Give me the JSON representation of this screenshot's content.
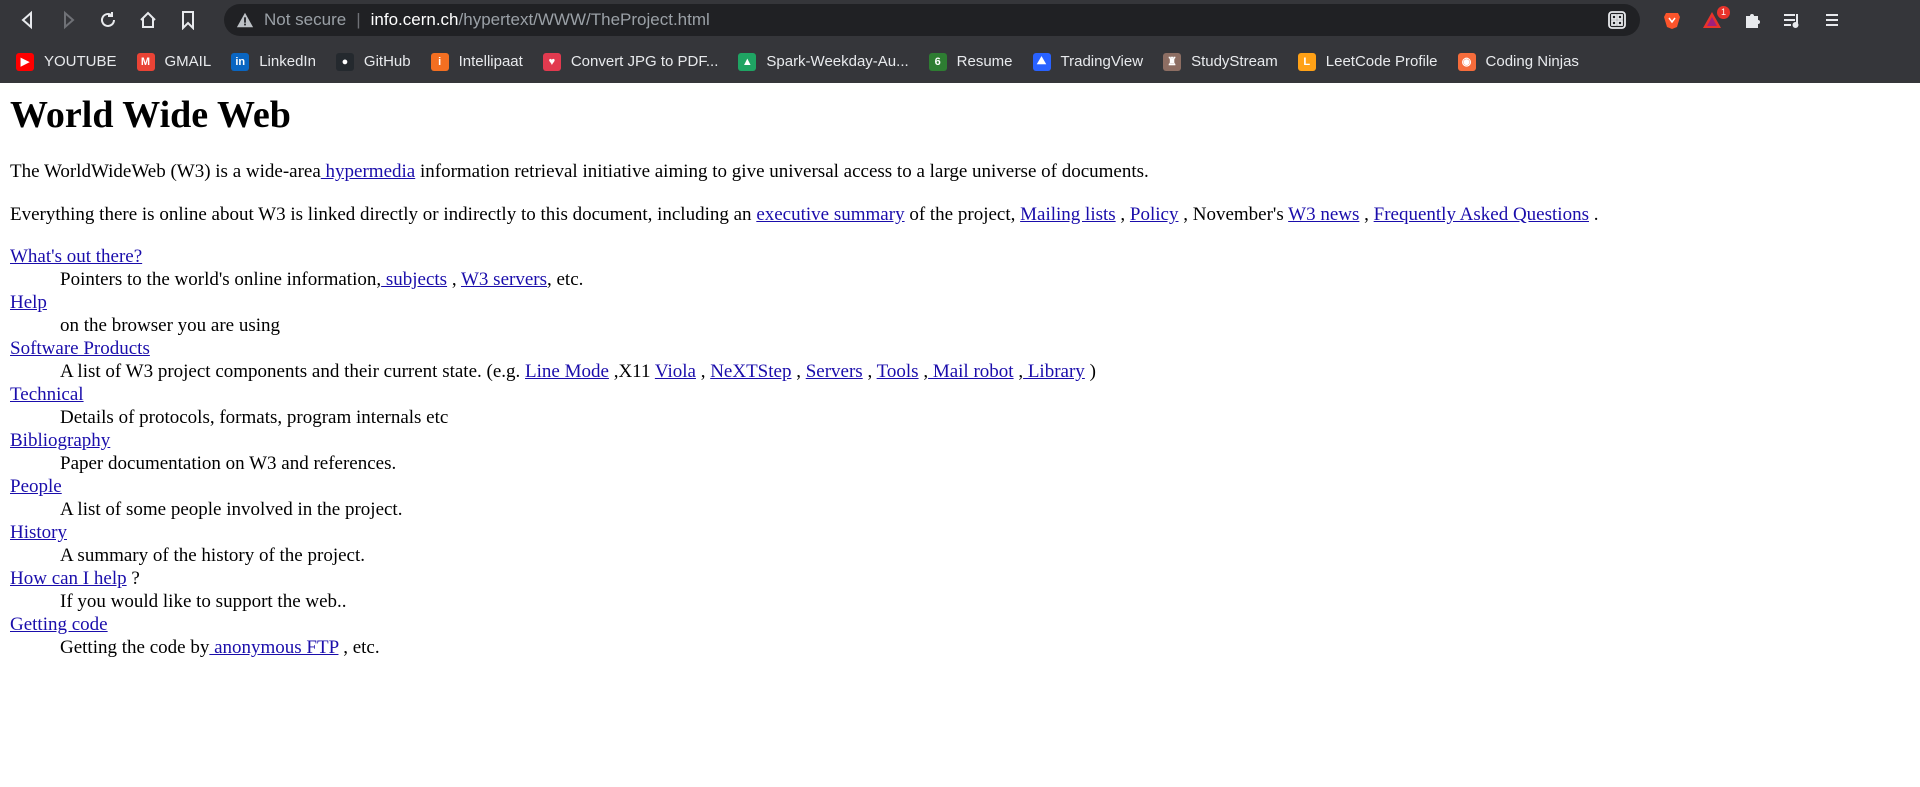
{
  "browser": {
    "address": {
      "security_label": "Not secure",
      "separator": "|",
      "host": "info.cern.ch",
      "path": "/hypertext/WWW/TheProject.html"
    },
    "extensions_badge": "1",
    "bookmarks": [
      {
        "label": "YOUTUBE",
        "icon": "youtube-icon",
        "color": "#ff0000",
        "glyph": "▶"
      },
      {
        "label": "GMAIL",
        "icon": "gmail-icon",
        "color": "#ea4335",
        "glyph": "M"
      },
      {
        "label": "LinkedIn",
        "icon": "linkedin-icon",
        "color": "#0a66c2",
        "glyph": "in"
      },
      {
        "label": "GitHub",
        "icon": "github-icon",
        "color": "#24292e",
        "glyph": "●"
      },
      {
        "label": "Intellipaat",
        "icon": "intellipaat-icon",
        "color": "#f36f21",
        "glyph": "i"
      },
      {
        "label": "Convert JPG to PDF...",
        "icon": "heart-icon",
        "color": "#e23a4f",
        "glyph": "♥"
      },
      {
        "label": "Spark-Weekday-Au...",
        "icon": "drive-icon",
        "color": "#1fa463",
        "glyph": "▲"
      },
      {
        "label": "Resume",
        "icon": "resume-icon",
        "color": "#2e7d32",
        "glyph": "6"
      },
      {
        "label": "TradingView",
        "icon": "tradingview-icon",
        "color": "#2962ff",
        "glyph": "⛰"
      },
      {
        "label": "StudyStream",
        "icon": "studystream-icon",
        "color": "#8d6e63",
        "glyph": "♜"
      },
      {
        "label": "LeetCode Profile",
        "icon": "leetcode-icon",
        "color": "#ffa116",
        "glyph": "L"
      },
      {
        "label": "Coding Ninjas",
        "icon": "codingninjas-icon",
        "color": "#f66c3b",
        "glyph": "◉"
      }
    ]
  },
  "page": {
    "title": "World Wide Web",
    "intro": {
      "t1": "The WorldWideWeb (W3) is a wide-area",
      "link_hypermedia": " hypermedia",
      "t2": " information retrieval initiative aiming to give universal access to a large universe of documents."
    },
    "everything": {
      "t1": "Everything there is online about W3 is linked directly or indirectly to this document, including an ",
      "link_exec": "executive summary",
      "t2": " of the project, ",
      "link_mailing": "Mailing lists",
      "t3": " , ",
      "link_policy": "Policy",
      "t4": " , November's ",
      "link_news": "W3 news",
      "t5": " , ",
      "link_faq": "Frequently Asked Questions",
      "t6": " ."
    },
    "sections": {
      "whats_out": {
        "term": "What's out there?",
        "d1": "Pointers to the world's online information,",
        "link_subjects": " subjects",
        "d2": " , ",
        "link_servers": "W3 servers",
        "d3": ", etc."
      },
      "help": {
        "term": "Help",
        "desc": "on the browser you are using"
      },
      "software": {
        "term": "Software Products",
        "d1": "A list of W3 project components and their current state. (e.g. ",
        "link_linemode": "Line Mode",
        "d2": " ,X11 ",
        "link_viola": "Viola",
        "d3": " , ",
        "link_nextstep": "NeXTStep",
        "d4": " , ",
        "link_servers": "Servers",
        "d5": " , ",
        "link_tools": "Tools",
        "d6": " ,",
        "link_mailrobot": " Mail robot",
        "d7": " ,",
        "link_library": " Library",
        "d8": " )"
      },
      "technical": {
        "term": "Technical",
        "desc": "Details of protocols, formats, program internals etc"
      },
      "bibliography": {
        "term": "Bibliography",
        "desc": "Paper documentation on W3 and references."
      },
      "people": {
        "term": "People",
        "desc": "A list of some people involved in the project."
      },
      "history": {
        "term": "History",
        "desc": "A summary of the history of the project."
      },
      "howhelp": {
        "term": "How can I help",
        "after": " ?",
        "desc": "If you would like to support the web.."
      },
      "getting_code": {
        "term": "Getting code",
        "d1": "Getting the code by",
        "link_ftp": " anonymous FTP",
        "d2": " , etc."
      }
    }
  }
}
